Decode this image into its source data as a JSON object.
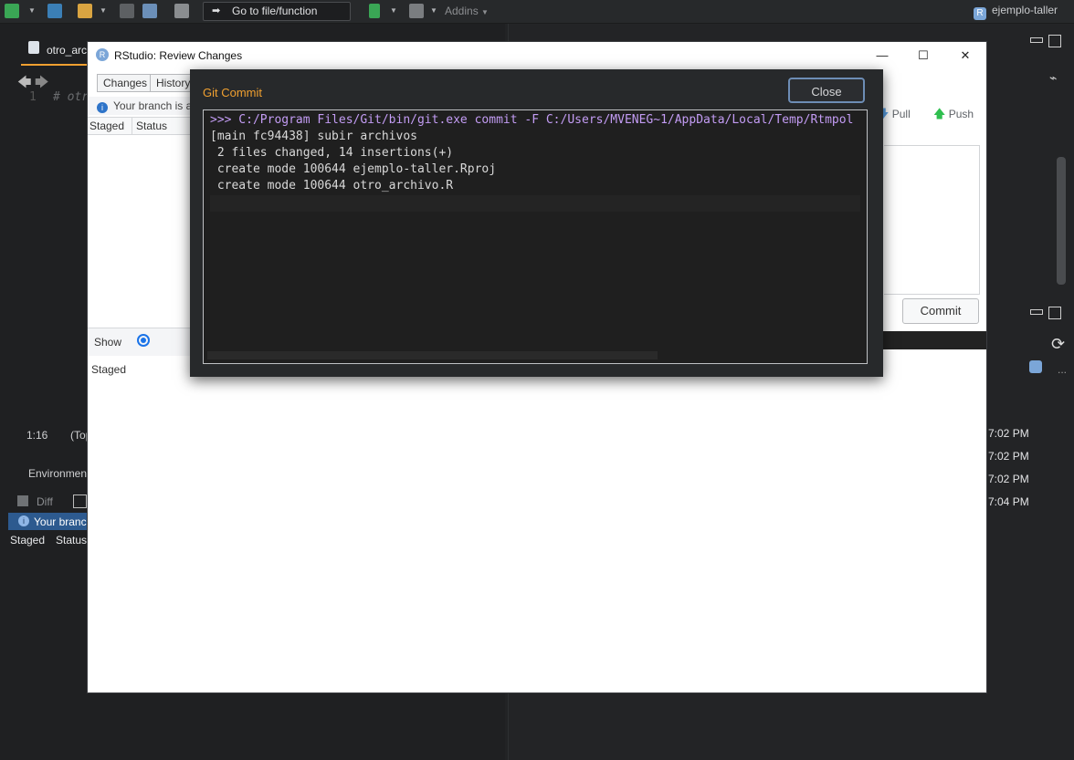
{
  "toolbar": {
    "goto_label": "Go to file/function",
    "goto_arrow": "➡",
    "addins_label": "Addins",
    "project_label": "ejemplo-taller",
    "project_icon_letter": "R"
  },
  "editor": {
    "tab_label": "otro_arc",
    "line_number": "1",
    "code_snippet": "# otr",
    "cursor_pos": "1:16",
    "scope": "(Top"
  },
  "bottom_left": {
    "env_tab": "Environment",
    "diff_label": "Diff",
    "branch_info": "Your branc",
    "col_staged": "Staged",
    "col_status": "Status"
  },
  "dialog": {
    "title": "RStudio: Review Changes",
    "icon_letter": "R",
    "tab_changes": "Changes",
    "tab_history": "History",
    "branch_info": "Your branch is a",
    "col_staged": "Staged",
    "col_status": "Status",
    "show_label": "Show",
    "staged_radio_label": "Staged",
    "pull_label": "Pull",
    "push_label": "Push",
    "commit_label": "Commit",
    "minimize_icon": "—",
    "maximize_icon": "☐",
    "close_icon": "✕"
  },
  "git_commit": {
    "title": "Git Commit",
    "close_label": "Close",
    "console_command": ">>> C:/Program Files/Git/bin/git.exe commit -F C:/Users/MVENEG~1/AppData/Local/Temp/Rtmpol",
    "console_lines": [
      "[main fc94438] subir archivos",
      " 2 files changed, 14 insertions(+)",
      " create mode 100644 ejemplo-taller.Rproj",
      " create mode 100644 otro_archivo.R"
    ]
  },
  "history_times": [
    "7:02 PM",
    "7:02 PM",
    "7:02 PM",
    "7:04 PM"
  ],
  "right_icons": {
    "refresh_icon": "⟳",
    "more_icon": "..."
  },
  "colors": {
    "accent_orange": "#f0a030",
    "console_command": "#c39cf4",
    "info_blue": "#2e74c9",
    "push_green": "#2fbf4f",
    "pull_blue": "#5aa0e6"
  }
}
